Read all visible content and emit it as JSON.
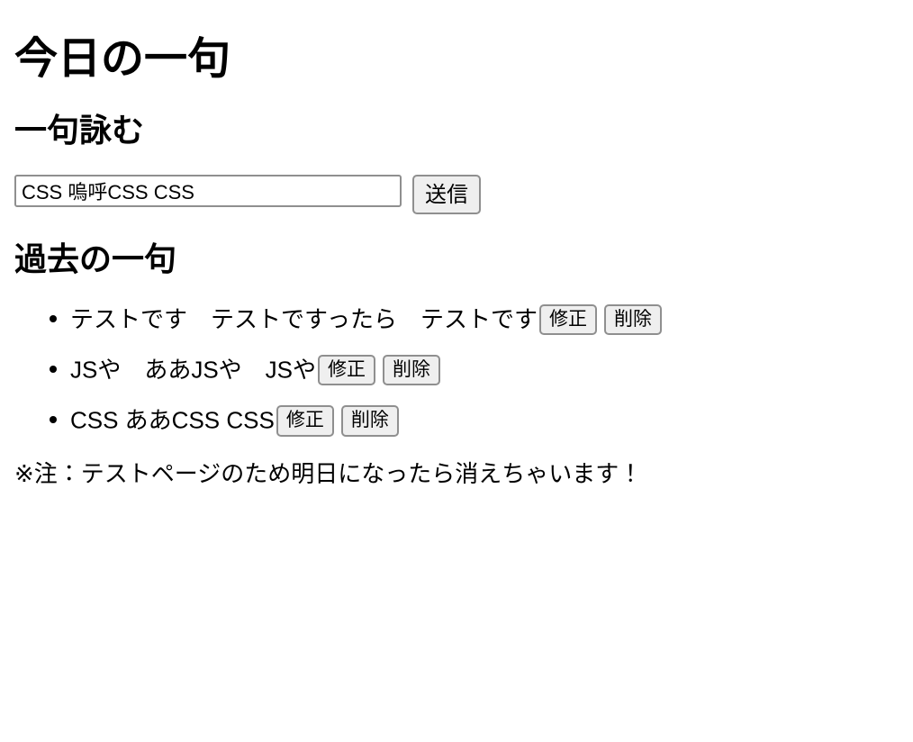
{
  "page": {
    "title": "今日の一句"
  },
  "compose": {
    "heading": "一句詠む",
    "input_value": "CSS 嗚呼CSS CSS",
    "input_placeholder": "",
    "submit_label": "送信"
  },
  "past": {
    "heading": "過去の一句",
    "edit_label": "修正",
    "delete_label": "削除",
    "items": [
      {
        "text": "テストです　テストですったら　テストです"
      },
      {
        "text": "JSや　ああJSや　JSや"
      },
      {
        "text": "CSS ああCSS CSS"
      }
    ]
  },
  "footer": {
    "note": "※注：テストページのため明日になったら消えちゃいます！"
  },
  "colors": {
    "text": "#000000",
    "background": "#ffffff",
    "button_face": "#efefef",
    "border": "#8f8f8f"
  }
}
